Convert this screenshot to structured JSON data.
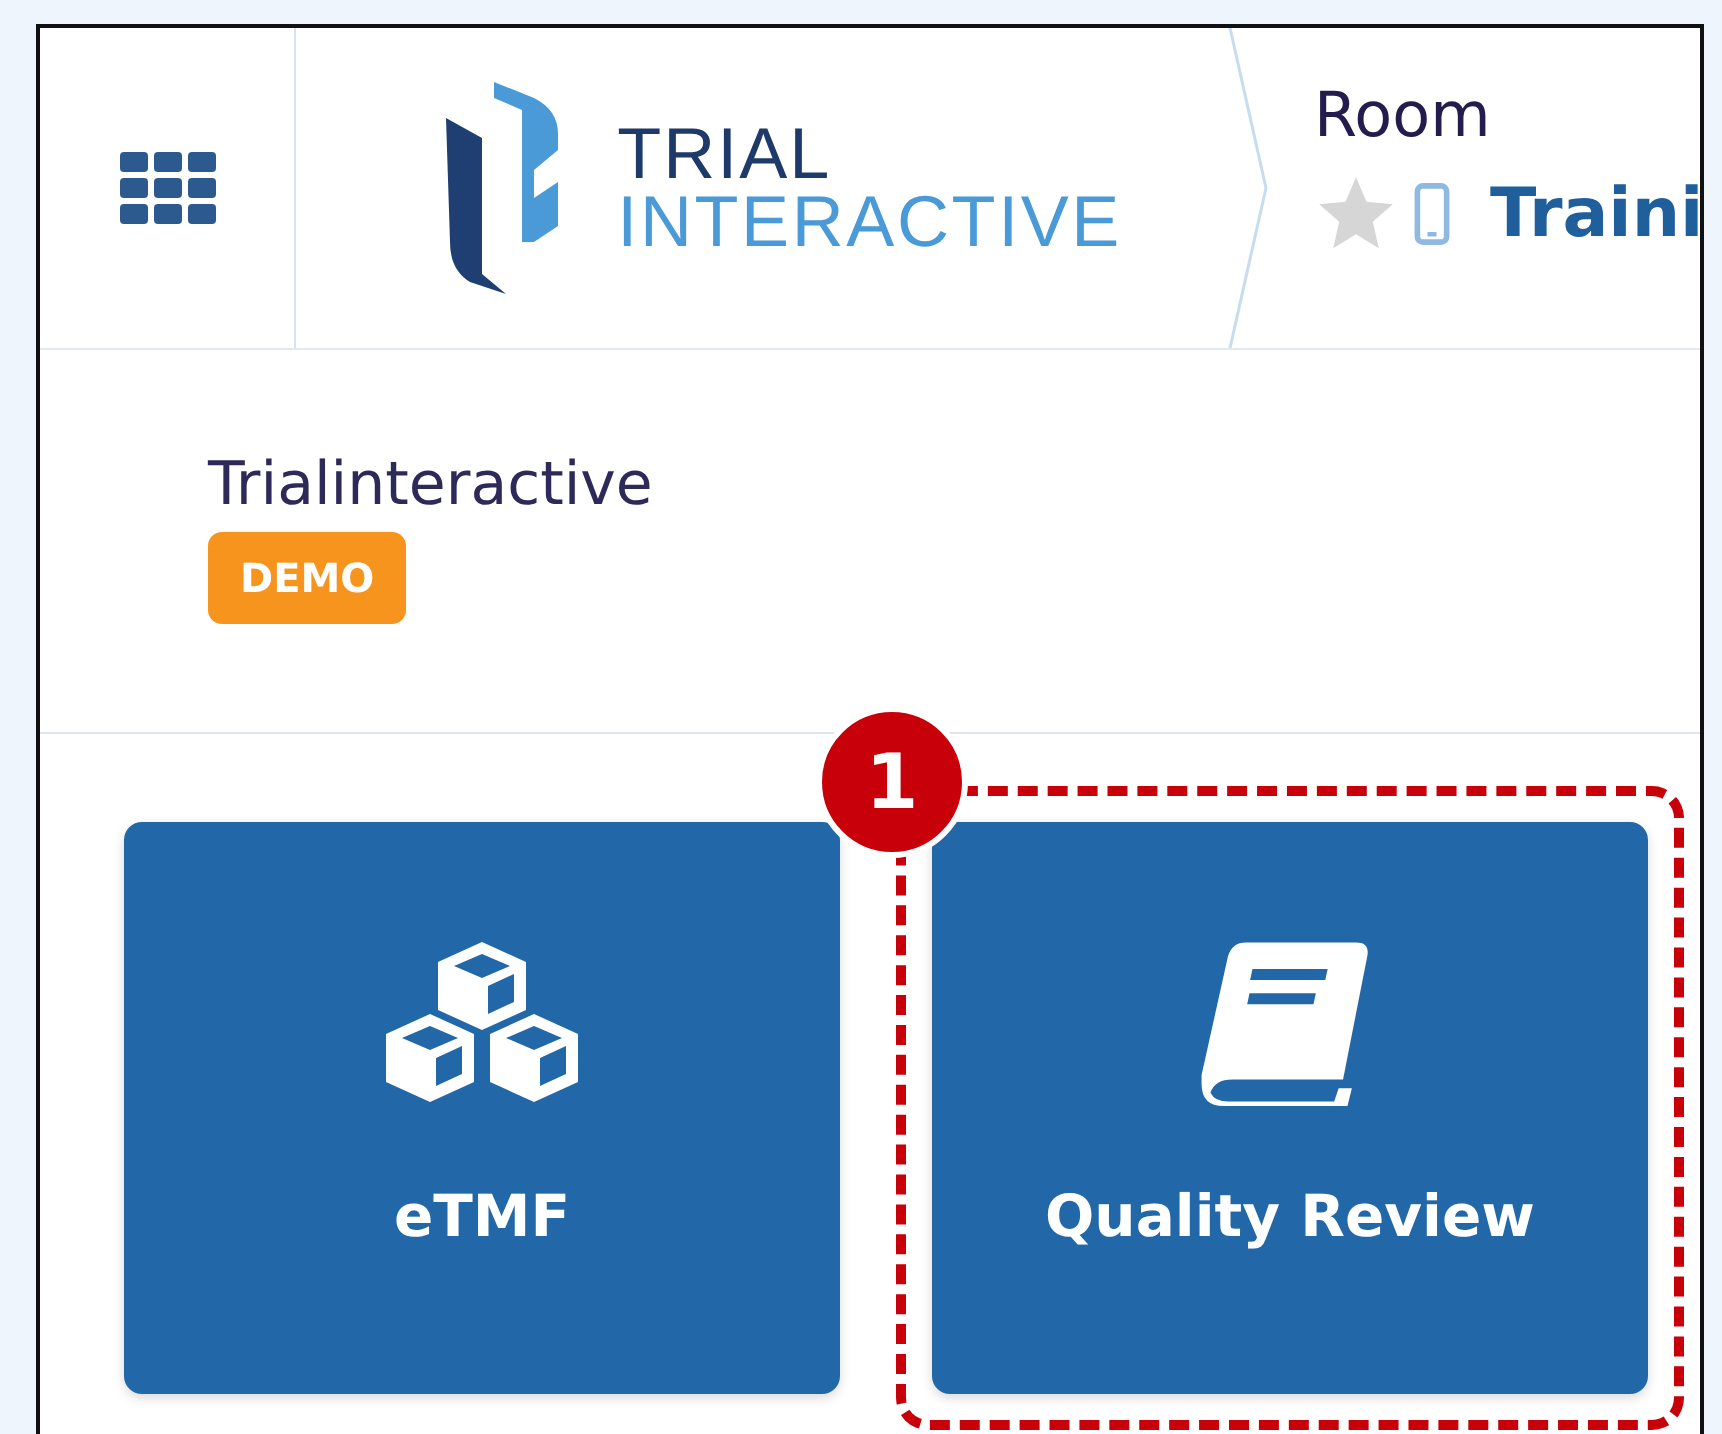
{
  "header": {
    "logo": {
      "line1": "TRIAL",
      "line2": "INTERACTIVE"
    },
    "breadcrumb": {
      "label": "Room",
      "title": "Traini",
      "favorite": false
    }
  },
  "organization": {
    "name": "Trialinteractive",
    "badge": "DEMO"
  },
  "tiles": [
    {
      "label": "eTMF",
      "highlighted": false
    },
    {
      "label": "Quality Review",
      "highlighted": true
    }
  ],
  "callout": {
    "number": "1"
  }
}
